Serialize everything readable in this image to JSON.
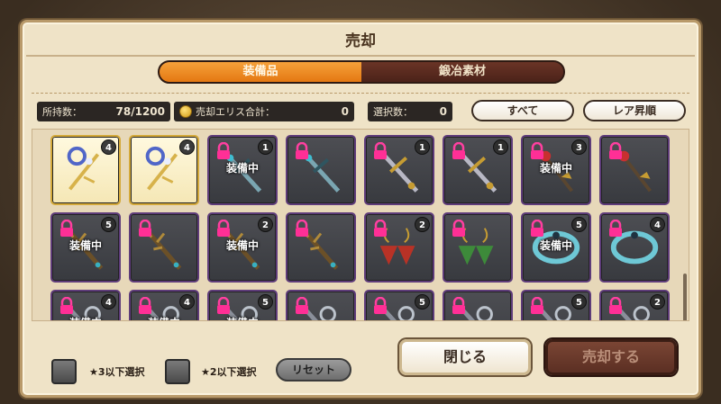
{
  "dialog": {
    "title": "売却"
  },
  "tabs": [
    {
      "label": "装備品",
      "active": true
    },
    {
      "label": "鍛冶素材",
      "active": false
    }
  ],
  "stats": {
    "owned_label": "所持数：",
    "owned_value": "78/1200",
    "eris_label": "売却エリス合計：",
    "eris_value": "0",
    "selected_label": "選択数：",
    "selected_value": "0"
  },
  "filters": {
    "all_label": "すべて",
    "sort_label": "レア昇順"
  },
  "equipped_text": "装備中",
  "items": [
    {
      "qty": "4",
      "locked": false,
      "equipped": false,
      "frame": "gold",
      "art": "staff-blue"
    },
    {
      "qty": "4",
      "locked": false,
      "equipped": false,
      "frame": "gold",
      "art": "staff-blue"
    },
    {
      "qty": "1",
      "locked": true,
      "equipped": true,
      "frame": "purple",
      "art": "sword-teal"
    },
    {
      "qty": "",
      "locked": true,
      "equipped": false,
      "frame": "purple",
      "art": "sword-teal"
    },
    {
      "qty": "1",
      "locked": true,
      "equipped": false,
      "frame": "purple",
      "art": "sword-gold"
    },
    {
      "qty": "1",
      "locked": true,
      "equipped": false,
      "frame": "purple",
      "art": "sword-gold"
    },
    {
      "qty": "3",
      "locked": true,
      "equipped": true,
      "frame": "purple",
      "art": "staff-red"
    },
    {
      "qty": "",
      "locked": true,
      "equipped": false,
      "frame": "purple",
      "art": "staff-red"
    },
    {
      "qty": "5",
      "locked": true,
      "equipped": true,
      "frame": "purple",
      "art": "branch-teal"
    },
    {
      "qty": "",
      "locked": true,
      "equipped": false,
      "frame": "purple",
      "art": "branch-teal"
    },
    {
      "qty": "2",
      "locked": true,
      "equipped": true,
      "frame": "purple",
      "art": "branch-teal"
    },
    {
      "qty": "",
      "locked": true,
      "equipped": false,
      "frame": "purple",
      "art": "branch-teal"
    },
    {
      "qty": "2",
      "locked": true,
      "equipped": false,
      "frame": "purple",
      "art": "earring-red"
    },
    {
      "qty": "",
      "locked": true,
      "equipped": false,
      "frame": "purple",
      "art": "earring-green"
    },
    {
      "qty": "5",
      "locked": true,
      "equipped": true,
      "frame": "purple",
      "art": "collar-teal"
    },
    {
      "qty": "4",
      "locked": true,
      "equipped": false,
      "frame": "purple",
      "art": "collar-teal"
    },
    {
      "qty": "4",
      "locked": true,
      "equipped": true,
      "frame": "purple",
      "art": "misc"
    },
    {
      "qty": "4",
      "locked": true,
      "equipped": true,
      "frame": "purple",
      "art": "misc"
    },
    {
      "qty": "5",
      "locked": true,
      "equipped": true,
      "frame": "purple",
      "art": "misc"
    },
    {
      "qty": "",
      "locked": true,
      "equipped": false,
      "frame": "purple",
      "art": "misc"
    },
    {
      "qty": "5",
      "locked": true,
      "equipped": false,
      "frame": "purple",
      "art": "misc"
    },
    {
      "qty": "",
      "locked": true,
      "equipped": false,
      "frame": "purple",
      "art": "misc"
    },
    {
      "qty": "5",
      "locked": true,
      "equipped": false,
      "frame": "purple",
      "art": "misc"
    },
    {
      "qty": "2",
      "locked": true,
      "equipped": false,
      "frame": "purple",
      "art": "misc"
    }
  ],
  "bottom": {
    "filter3_label": "★3以下選択",
    "filter2_label": "★2以下選択",
    "reset_label": "リセット",
    "close_label": "閉じる",
    "sell_label": "売却する"
  }
}
